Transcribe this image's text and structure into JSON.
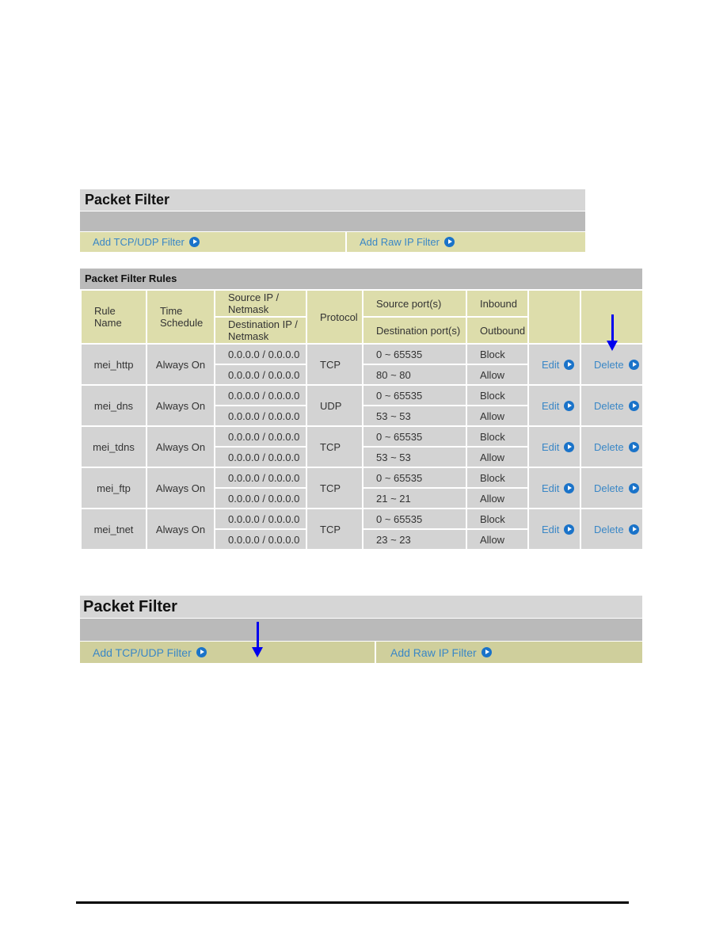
{
  "panel_top": {
    "title": "Packet Filter",
    "links": [
      {
        "label": "Add TCP/UDP Filter",
        "icon": "go-arrow-icon"
      },
      {
        "label": "Add Raw IP Filter",
        "icon": "go-arrow-icon"
      }
    ]
  },
  "rules": {
    "title": "Packet Filter Rules",
    "headers": {
      "rule_name": "Rule Name",
      "time_schedule": "Time Schedule",
      "source_ip": "Source IP / Netmask",
      "dest_ip": "Destination IP / Netmask",
      "protocol": "Protocol",
      "source_ports": "Source port(s)",
      "dest_ports": "Destination port(s)",
      "inbound": "Inbound",
      "outbound": "Outbound"
    },
    "rows": [
      {
        "name": "mei_http",
        "schedule": "Always On",
        "src_ip": "0.0.0.0 / 0.0.0.0",
        "dst_ip": "0.0.0.0 / 0.0.0.0",
        "protocol": "TCP",
        "src_port": "0 ~ 65535",
        "dst_port": "80 ~ 80",
        "inbound": "Block",
        "outbound": "Allow",
        "edit": "Edit",
        "delete": "Delete"
      },
      {
        "name": "mei_dns",
        "schedule": "Always On",
        "src_ip": "0.0.0.0 / 0.0.0.0",
        "dst_ip": "0.0.0.0 / 0.0.0.0",
        "protocol": "UDP",
        "src_port": "0 ~ 65535",
        "dst_port": "53 ~ 53",
        "inbound": "Block",
        "outbound": "Allow",
        "edit": "Edit",
        "delete": "Delete"
      },
      {
        "name": "mei_tdns",
        "schedule": "Always On",
        "src_ip": "0.0.0.0 / 0.0.0.0",
        "dst_ip": "0.0.0.0 / 0.0.0.0",
        "protocol": "TCP",
        "src_port": "0 ~ 65535",
        "dst_port": "53 ~ 53",
        "inbound": "Block",
        "outbound": "Allow",
        "edit": "Edit",
        "delete": "Delete"
      },
      {
        "name": "mei_ftp",
        "schedule": "Always On",
        "src_ip": "0.0.0.0 / 0.0.0.0",
        "dst_ip": "0.0.0.0 / 0.0.0.0",
        "protocol": "TCP",
        "src_port": "0 ~ 65535",
        "dst_port": "21 ~ 21",
        "inbound": "Block",
        "outbound": "Allow",
        "edit": "Edit",
        "delete": "Delete"
      },
      {
        "name": "mei_tnet",
        "schedule": "Always On",
        "src_ip": "0.0.0.0 / 0.0.0.0",
        "dst_ip": "0.0.0.0 / 0.0.0.0",
        "protocol": "TCP",
        "src_port": "0 ~ 65535",
        "dst_port": "23 ~ 23",
        "inbound": "Block",
        "outbound": "Allow",
        "edit": "Edit",
        "delete": "Delete"
      }
    ]
  },
  "panel_bottom": {
    "title": "Packet Filter",
    "links": [
      {
        "label": "Add TCP/UDP Filter",
        "icon": "go-arrow-icon"
      },
      {
        "label": "Add Raw IP Filter",
        "icon": "go-arrow-icon"
      }
    ]
  },
  "annotations": {
    "arrow_color": "#0000ee",
    "link_color": "#3a87c6"
  }
}
